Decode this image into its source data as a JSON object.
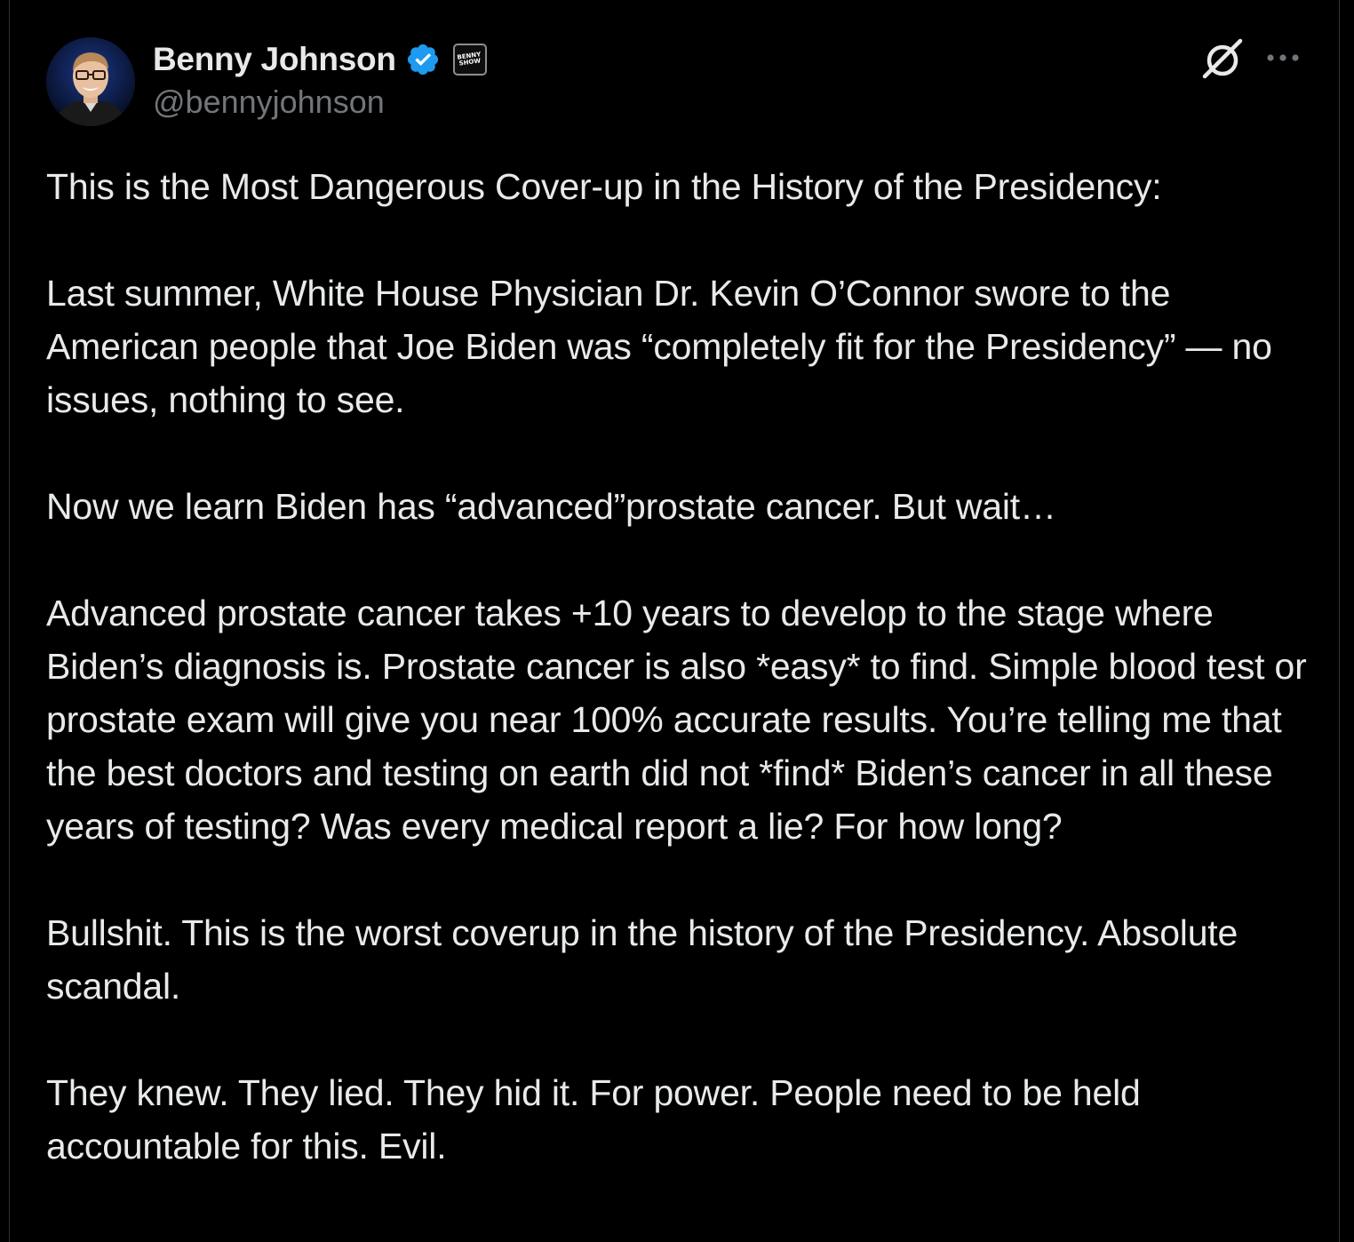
{
  "tweet": {
    "author": {
      "display_name": "Benny Johnson",
      "handle": "@bennyjohnson",
      "verified": true,
      "verified_color": "#1d9bf0",
      "affiliate_badge_text": "BENNY\nSHOW"
    },
    "actions": {
      "grok_icon": "grok-icon",
      "more_icon": "more-icon"
    },
    "paragraphs": [
      "This is the Most Dangerous Cover-up in the History of the Presidency:",
      "Last summer, White House Physician Dr. Kevin O’Connor swore to the American people that Joe Biden was “completely fit for the Presidency” — no issues, nothing to see.",
      "Now we learn Biden has “advanced”prostate cancer. But wait…",
      "Advanced prostate cancer takes +10 years to develop to the stage where Biden’s diagnosis is. Prostate cancer is also *easy* to find. Simple blood test or prostate exam will give you near 100% accurate results. You’re telling me that the best doctors and testing on earth did not *find* Biden’s cancer in all these years of testing? Was every medical report a lie? For how long?",
      "Bullshit. This is the worst coverup in the history of the Presidency. Absolute scandal.",
      "They knew. They lied. They hid it. For power. People need to be held accountable for this. Evil."
    ]
  },
  "colors": {
    "background": "#000000",
    "text_primary": "#e7e9ea",
    "text_secondary": "#71767b",
    "border": "#2f3336"
  }
}
